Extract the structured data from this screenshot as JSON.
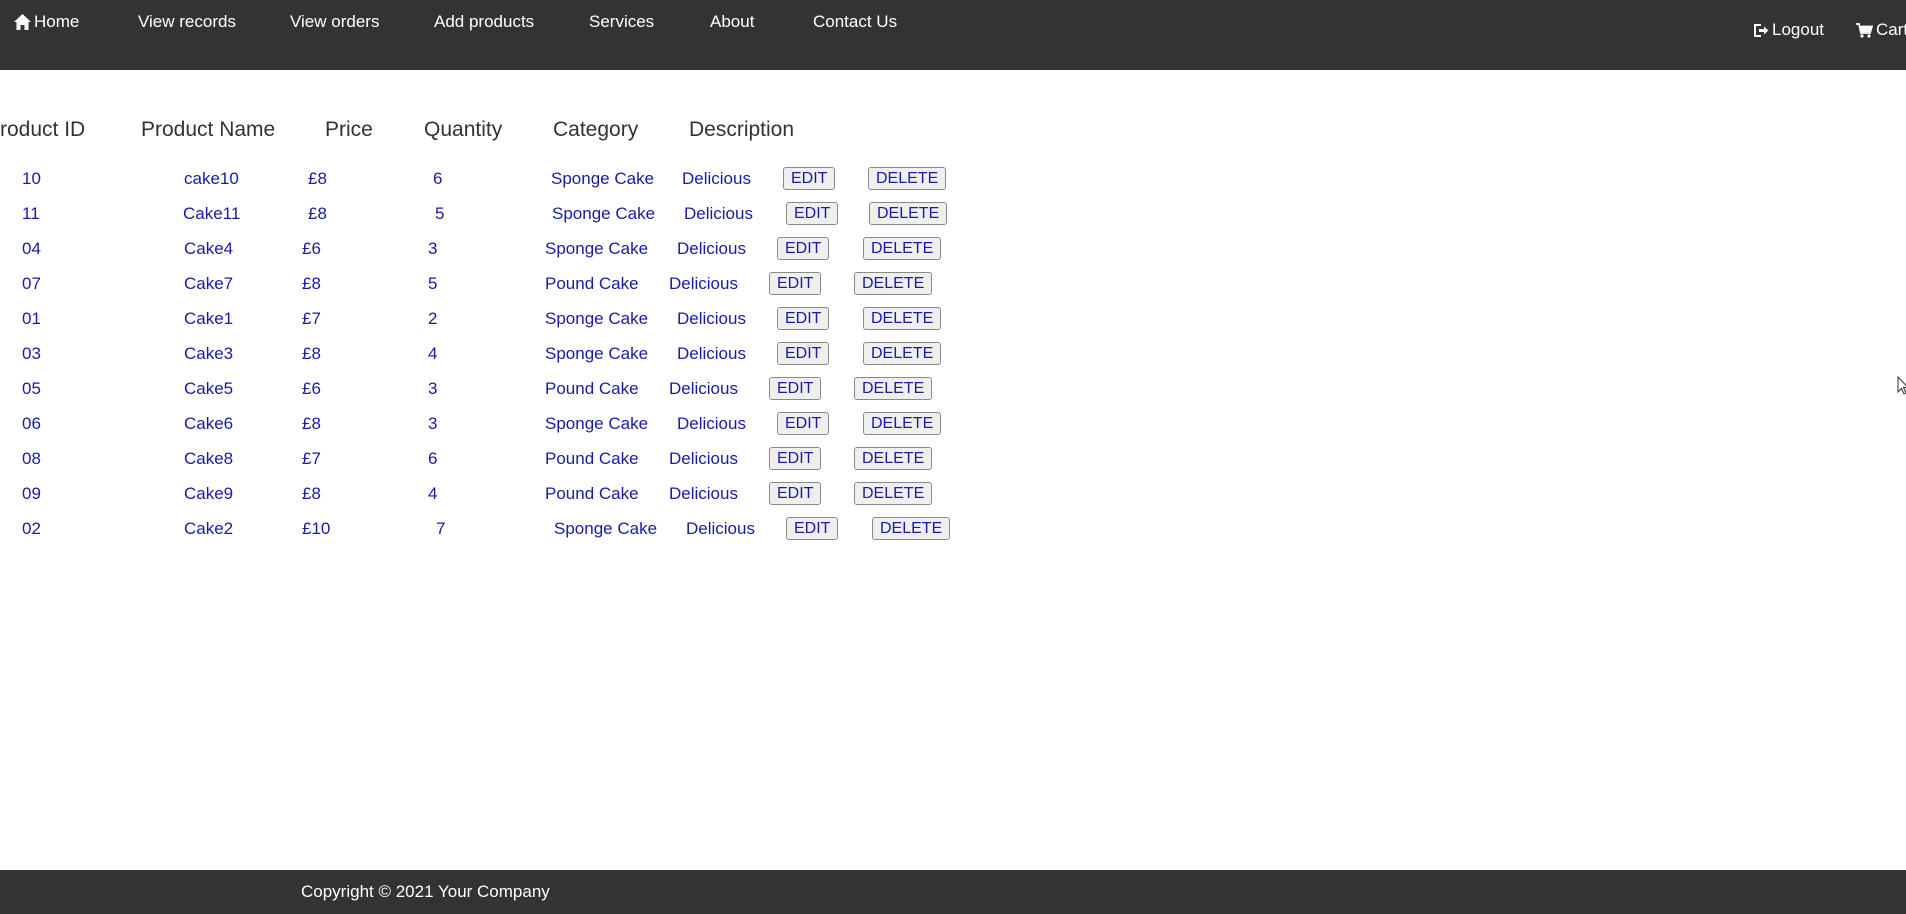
{
  "nav": {
    "home": "Home",
    "view_records": "View records",
    "view_orders": "View orders",
    "add_products": "Add products",
    "services": "Services",
    "about": "About",
    "contact_us": "Contact Us",
    "logout": "Logout",
    "cart": "Cart"
  },
  "table": {
    "headers": [
      "roduct ID",
      "Product Name",
      "Price",
      "Quantity",
      "Category",
      "Description"
    ],
    "edit_label": "EDIT",
    "delete_label": "DELETE",
    "rows": [
      {
        "id": "10",
        "name": "cake10",
        "price": "£8",
        "quantity": "6",
        "category": "Sponge Cake",
        "description": "Delicious"
      },
      {
        "id": "11",
        "name": "Cake11",
        "price": "£8",
        "quantity": "5",
        "category": "Sponge Cake",
        "description": "Delicious"
      },
      {
        "id": "04",
        "name": "Cake4",
        "price": "£6",
        "quantity": "3",
        "category": "Sponge Cake",
        "description": "Delicious"
      },
      {
        "id": "07",
        "name": "Cake7",
        "price": "£8",
        "quantity": "5",
        "category": "Pound Cake",
        "description": "Delicious"
      },
      {
        "id": "01",
        "name": "Cake1",
        "price": "£7",
        "quantity": "2",
        "category": "Sponge Cake",
        "description": "Delicious"
      },
      {
        "id": "03",
        "name": "Cake3",
        "price": "£8",
        "quantity": "4",
        "category": "Sponge Cake",
        "description": "Delicious"
      },
      {
        "id": "05",
        "name": "Cake5",
        "price": "£6",
        "quantity": "3",
        "category": "Pound Cake",
        "description": "Delicious"
      },
      {
        "id": "06",
        "name": "Cake6",
        "price": "£8",
        "quantity": "3",
        "category": "Sponge Cake",
        "description": "Delicious"
      },
      {
        "id": "08",
        "name": "Cake8",
        "price": "£7",
        "quantity": "6",
        "category": "Pound Cake",
        "description": "Delicious"
      },
      {
        "id": "09",
        "name": "Cake9",
        "price": "£8",
        "quantity": "4",
        "category": "Pound Cake",
        "description": "Delicious"
      },
      {
        "id": "02",
        "name": "Cake2",
        "price": "£10",
        "quantity": "7",
        "category": "Sponge Cake",
        "description": "Delicious"
      }
    ]
  },
  "footer": {
    "copyright": "Copyright © 2021 Your Company"
  },
  "icons": {
    "home": "home-icon",
    "logout": "logout-icon",
    "cart": "cart-icon",
    "cursor": "mouse-cursor-icon"
  },
  "colors": {
    "navbar_bg": "#333333",
    "text_link": "#1a1aa6",
    "header_text": "#333333"
  }
}
